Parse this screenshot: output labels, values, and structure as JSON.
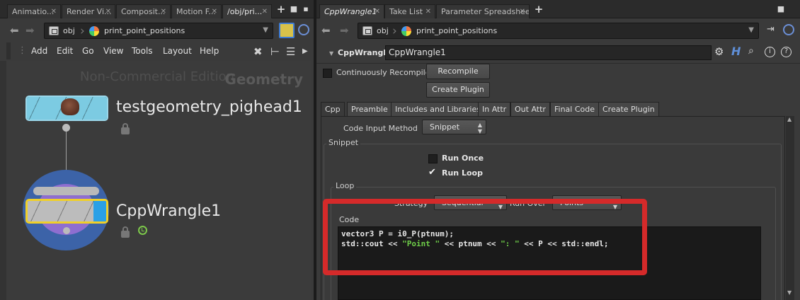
{
  "left": {
    "tabs": [
      {
        "label": "Animatio..."
      },
      {
        "label": "Render Vi..."
      },
      {
        "label": "Composit..."
      },
      {
        "label": "Motion F..."
      },
      {
        "label": "/obj/pri..."
      }
    ],
    "path": {
      "obj": "obj",
      "node": "print_point_positions"
    },
    "menu": [
      "Add",
      "Edit",
      "Go",
      "View",
      "Tools",
      "Layout",
      "Help"
    ],
    "network": {
      "watermark": "Non-Commercial Edition",
      "context": "Geometry",
      "nodes": [
        {
          "name": "testgeometry_pighead1",
          "color": "#7ccbe2"
        },
        {
          "name": "CppWrangle1",
          "color": "#2aa0e6"
        }
      ]
    }
  },
  "right": {
    "tabs": [
      {
        "label": "CppWrangle1"
      },
      {
        "label": "Take List"
      },
      {
        "label": "Parameter Spreadsheet"
      }
    ],
    "path": {
      "obj": "obj",
      "node": "print_point_positions"
    },
    "node_type": "CppWrangle",
    "node_name": "CppWrangle1",
    "continuously_recompile": {
      "label": "Continuously Recompile",
      "checked": false
    },
    "recompile_label": "Recompile",
    "create_plugin_label": "Create Plugin",
    "param_tabs": [
      "Cpp",
      "Preamble",
      "Includes and Libraries",
      "In Attr",
      "Out Attr",
      "Final Code",
      "Create Plugin"
    ],
    "code_input_method": {
      "label": "Code Input Method",
      "value": "Snippet"
    },
    "snippet_group": "Snippet",
    "run_once": {
      "label": "Run Once",
      "checked": false
    },
    "run_loop": {
      "label": "Run Loop",
      "checked": true
    },
    "loop_group": "Loop",
    "strategy": {
      "label": "Strategy",
      "value": "Sequential"
    },
    "run_over": {
      "label": "Run Over",
      "value": "Points"
    },
    "code": {
      "label": "Code",
      "line1": "vector3 P = i0_P(ptnum);",
      "line2_pre": "std::cout << ",
      "line2_str1": "\"Point \"",
      "line2_mid": " << ptnum << ",
      "line2_str2": "\": \"",
      "line2_post": " << P << std::endl;"
    },
    "highlight_color": "#d52a2a"
  }
}
